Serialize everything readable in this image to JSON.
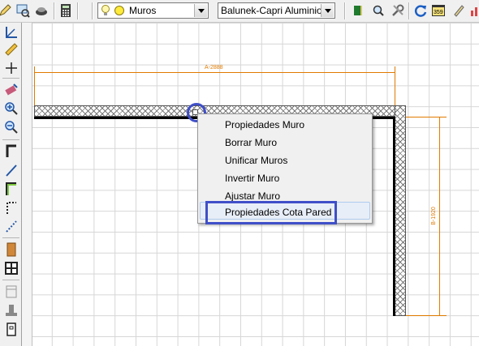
{
  "toolbar": {
    "layer_combo": {
      "value": "Muros"
    },
    "profile_combo": {
      "value": "Balunek-Capri Aluminio"
    }
  },
  "drawing": {
    "dim_top_label": "A-2888",
    "dim_right_label": "B-1920"
  },
  "context_menu": {
    "items": [
      {
        "label": "Propiedades Muro"
      },
      {
        "label": "Borrar Muro"
      },
      {
        "label": "Unificar Muros"
      },
      {
        "label": "Invertir Muro"
      },
      {
        "label": "Ajustar Muro"
      },
      {
        "label": "Propiedades Cota Pared"
      }
    ],
    "highlighted_index": 5
  },
  "colors": {
    "dimension": "#e07b00",
    "annotation": "#3f4fc8",
    "wall_line": "#000000",
    "grid": "#d6d6d6"
  }
}
